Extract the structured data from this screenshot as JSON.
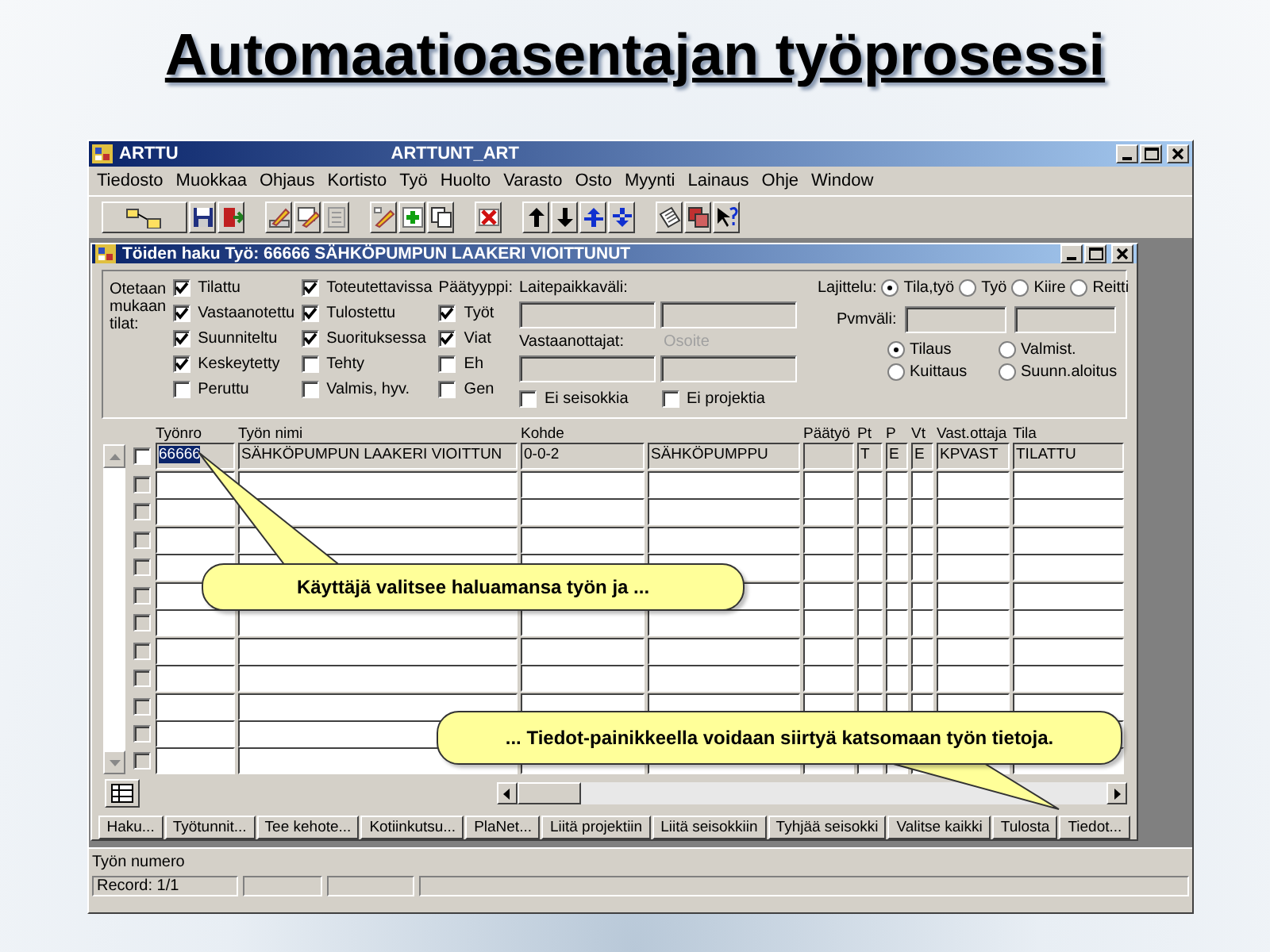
{
  "slide_title": "Automaatioasentajan työprosessi",
  "app_window": {
    "title": "ARTTU",
    "module": "ARTTUNT_ART"
  },
  "menu": [
    "Tiedosto",
    "Muokkaa",
    "Ohjaus",
    "Kortisto",
    "Työ",
    "Huolto",
    "Varasto",
    "Osto",
    "Myynti",
    "Lainaus",
    "Ohje",
    "Window"
  ],
  "search_window": {
    "title": "Töiden haku  Työ: 66666 SÄHKÖPUMPUN LAAKERI VIOITTUNUT"
  },
  "status_filter": {
    "label": "Otetaan mukaan tilat:",
    "options": [
      {
        "label": "Tilattu",
        "checked": true
      },
      {
        "label": "Vastaanotettu",
        "checked": true
      },
      {
        "label": "Suunniteltu",
        "checked": true
      },
      {
        "label": "Keskeytetty",
        "checked": true
      },
      {
        "label": "Peruttu",
        "checked": false
      },
      {
        "label": "Toteutettavissa",
        "checked": true
      },
      {
        "label": "Tulostettu",
        "checked": true
      },
      {
        "label": "Suorituksessa",
        "checked": true
      },
      {
        "label": "Tehty",
        "checked": false
      },
      {
        "label": "Valmis, hyv.",
        "checked": false
      }
    ]
  },
  "end_type": {
    "label": "Päätyyppi:",
    "options": [
      {
        "label": "Työt",
        "checked": true
      },
      {
        "label": "Viat",
        "checked": true
      },
      {
        "label": "Eh",
        "checked": false
      },
      {
        "label": "Gen",
        "checked": false
      }
    ]
  },
  "fields": {
    "device_range_label": "Laitepaikkaväli:",
    "recipients_label": "Vastaanottajat:",
    "address_label": "Osoite",
    "address_disabled": true
  },
  "exclude": [
    {
      "label": "Ei seisokkia",
      "checked": false
    },
    {
      "label": "Ei projektia",
      "checked": false
    }
  ],
  "sort": {
    "label": "Lajittelu:",
    "options": [
      {
        "label": "Tila,työ",
        "selected": true
      },
      {
        "label": "Työ",
        "selected": false
      },
      {
        "label": "Kiire",
        "selected": false
      },
      {
        "label": "Reitti",
        "selected": false
      }
    ]
  },
  "date_range": {
    "label": "Pvmväli:",
    "options": [
      {
        "label": "Tilaus",
        "selected": true
      },
      {
        "label": "Valmist.",
        "selected": false
      },
      {
        "label": "Kuittaus",
        "selected": false
      },
      {
        "label": "Suunn.aloitus",
        "selected": false
      }
    ]
  },
  "grid": {
    "columns": [
      {
        "label": "Työnro"
      },
      {
        "label": "Työn nimi"
      },
      {
        "label": "Kohde"
      },
      {},
      {
        "label": "Päätyö"
      },
      {
        "label": "Pt"
      },
      {
        "label": "P"
      },
      {
        "label": "Vt"
      },
      {
        "label": "Vast.ottaja"
      },
      {
        "label": "Tila"
      }
    ],
    "rows": [
      {
        "checked": false,
        "cells": [
          {
            "text": "66666",
            "selected": true
          },
          {
            "text": "SÄHKÖPUMPUN LAAKERI VIOITTUN",
            "selected": false
          },
          {
            "text": "0-0-2",
            "selected": false
          },
          {
            "text": "SÄHKÖPUMPPU",
            "selected": false
          },
          {
            "selected": false
          },
          {
            "text": "T",
            "selected": false
          },
          {
            "text": "E",
            "selected": false
          },
          {
            "text": "E",
            "selected": false
          },
          {
            "text": "KPVAST",
            "selected": false
          },
          {
            "text": "TILATTU",
            "selected": false
          }
        ]
      },
      {
        "checked": false
      },
      {
        "checked": false
      },
      {
        "checked": false
      },
      {
        "checked": false
      },
      {
        "checked": false
      },
      {
        "checked": false
      },
      {
        "checked": false
      },
      {
        "checked": false
      },
      {
        "checked": false
      },
      {
        "checked": false
      },
      {
        "checked": false
      }
    ]
  },
  "buttons": [
    "Haku...",
    "Työtunnit...",
    "Tee kehote...",
    "Kotiinkutsu...",
    "PlaNet...",
    "Liitä projektiin",
    "Liitä seisokkiin",
    "Tyhjää seisokki",
    "Valitse kaikki",
    "Tulosta",
    "Tiedot..."
  ],
  "status_bar": {
    "hint": "Työn numero",
    "record": "Record: 1/1"
  },
  "callouts": [
    {
      "text": "Käyttäjä valitsee haluamansa työn ja ..."
    },
    {
      "text": "... Tiedot-painikkeella voidaan siirtyä katsomaan työn tietoja."
    }
  ]
}
